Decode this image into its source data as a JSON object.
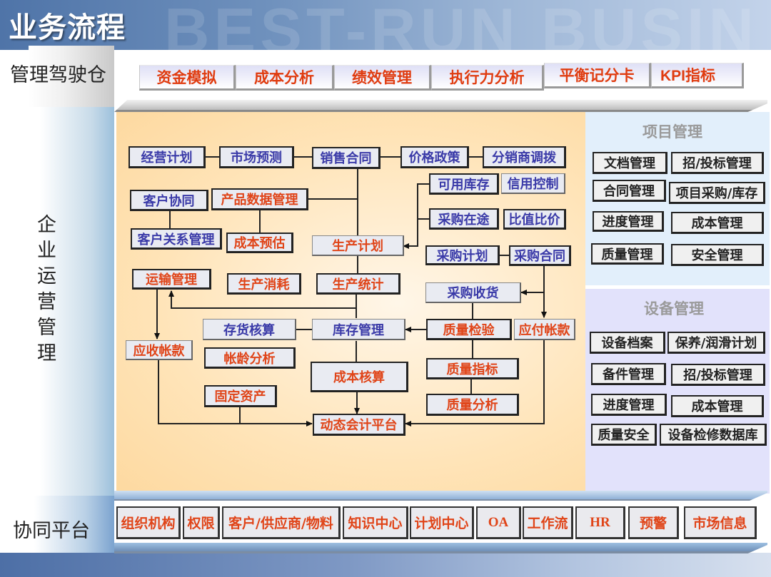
{
  "header": {
    "title": "业务流程",
    "watermark": "BEST-RUN BUSIN"
  },
  "sections": {
    "cockpit_label": "管理驾驶仓",
    "operations_label": "企业运营管理",
    "collaboration_label": "协同平台"
  },
  "cockpit_tabs": [
    {
      "label": "资金模拟"
    },
    {
      "label": "成本分析"
    },
    {
      "label": "绩效管理"
    },
    {
      "label": "执行力分析"
    },
    {
      "label": "平衡记分卡"
    },
    {
      "label": "KPI指标"
    }
  ],
  "flow_nodes": {
    "business_plan": "经营计划",
    "market_forecast": "市场预测",
    "sales_contract": "销售合同",
    "price_policy": "价格政策",
    "distributor_allocation": "分销商调拨",
    "available_inventory": "可用库存",
    "credit_control": "信用控制",
    "customer_collab": "客户协同",
    "product_data_mgmt": "产品数据管理",
    "purchase_in_transit": "采购在途",
    "price_comparison": "比值比价",
    "crm": "客户关系管理",
    "cost_estimate": "成本预估",
    "production_plan": "生产计划",
    "purchase_plan": "采购计划",
    "purchase_contract": "采购合同",
    "transport_mgmt": "运输管理",
    "production_consumption": "生产消耗",
    "production_stats": "生产统计",
    "purchase_receipt": "采购收货",
    "inventory_accounting": "存货核算",
    "inventory_mgmt": "库存管理",
    "quality_inspection": "质量检验",
    "accounts_payable": "应付帐款",
    "accounts_receivable": "应收帐款",
    "aging_analysis": "帐龄分析",
    "cost_accounting": "成本核算",
    "quality_index": "质量指标",
    "fixed_assets": "固定资产",
    "quality_analysis": "质量分析",
    "dynamic_accounting_platform": "动态会计平台"
  },
  "project_mgmt": {
    "title": "项目管理",
    "items": [
      "文档管理",
      "招/投标管理",
      "合同管理",
      "项目采购/库存",
      "进度管理",
      "成本管理",
      "质量管理",
      "安全管理"
    ]
  },
  "equipment_mgmt": {
    "title": "设备管理",
    "items": [
      "设备档案",
      "保养/润滑计划",
      "备件管理",
      "招/投标管理",
      "进度管理",
      "成本管理",
      "质量安全",
      "设备检修数据库"
    ]
  },
  "collab_tabs": [
    {
      "label": "组织机构"
    },
    {
      "label": "权限"
    },
    {
      "label": "客户/供应商/物料"
    },
    {
      "label": "知识中心"
    },
    {
      "label": "计划中心"
    },
    {
      "label": "OA"
    },
    {
      "label": "工作流"
    },
    {
      "label": "HR"
    },
    {
      "label": "预警"
    },
    {
      "label": "市场信息"
    }
  ],
  "colors": {
    "accent_red": "#e04418",
    "node_blue": "#3a3aa8",
    "flow_bg": "#ffe4b8",
    "project_bg": "#e2effb",
    "equipment_bg": "#e2e2fb"
  }
}
